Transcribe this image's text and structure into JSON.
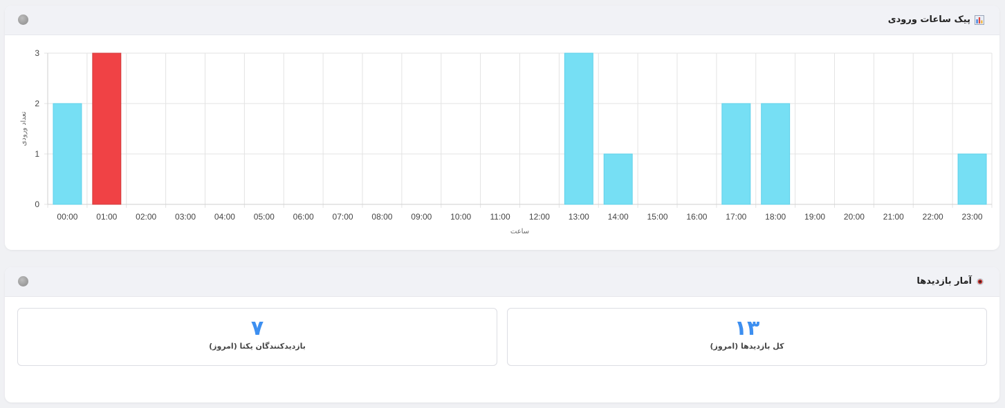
{
  "peak_card": {
    "title": "پیک ساعات ورودی",
    "icon": "bar-chart-icon"
  },
  "visits_card": {
    "title": "آمار بازدیدها",
    "icon": "eye-icon",
    "stats": [
      {
        "value": "۱۳",
        "label": "کل بازدیدها (امروز)"
      },
      {
        "value": "۷",
        "label": "بازدیدکنندگان یکتا (امروز)"
      }
    ]
  },
  "colors": {
    "bar": "#76dff4",
    "bar_highlight": "#f04245",
    "value_text": "#3d8ff0"
  },
  "chart_data": {
    "type": "bar",
    "categories": [
      "00:00",
      "01:00",
      "02:00",
      "03:00",
      "04:00",
      "05:00",
      "06:00",
      "07:00",
      "08:00",
      "09:00",
      "10:00",
      "11:00",
      "12:00",
      "13:00",
      "14:00",
      "15:00",
      "16:00",
      "17:00",
      "18:00",
      "19:00",
      "20:00",
      "21:00",
      "22:00",
      "23:00"
    ],
    "values": [
      2,
      3,
      0,
      0,
      0,
      0,
      0,
      0,
      0,
      0,
      0,
      0,
      0,
      3,
      1,
      0,
      0,
      2,
      2,
      0,
      0,
      0,
      0,
      1
    ],
    "highlight_index": 1,
    "xlabel": "ساعت",
    "ylabel": "تعداد ورودی",
    "ylim": [
      0,
      3
    ],
    "yticks": [
      0,
      1,
      2,
      3
    ],
    "grid": true
  }
}
